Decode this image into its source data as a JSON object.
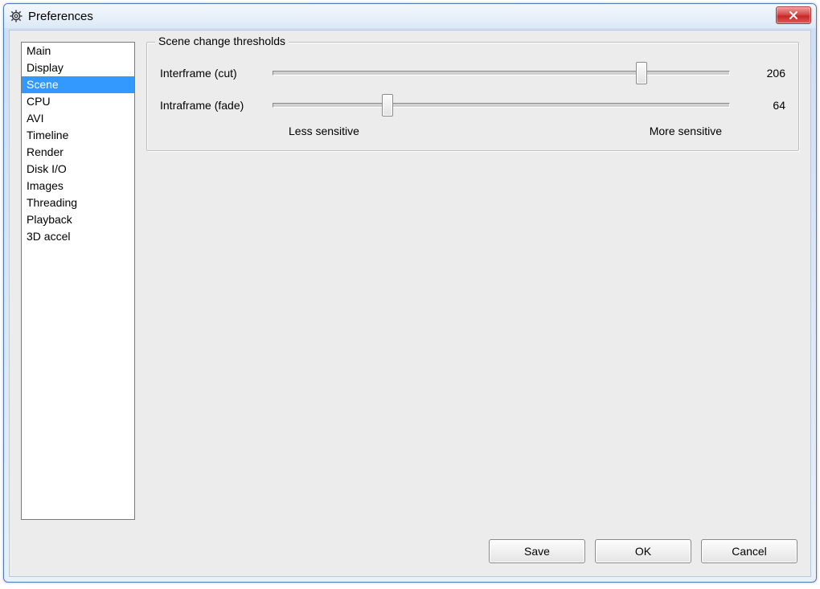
{
  "window": {
    "title": "Preferences"
  },
  "sidebar": {
    "items": [
      "Main",
      "Display",
      "Scene",
      "CPU",
      "AVI",
      "Timeline",
      "Render",
      "Disk I/O",
      "Images",
      "Threading",
      "Playback",
      "3D accel"
    ],
    "selected_index": 2
  },
  "group": {
    "title": "Scene change thresholds",
    "sliders": {
      "interframe": {
        "label": "Interframe (cut)",
        "value": 206,
        "min": 0,
        "max": 255
      },
      "intraframe": {
        "label": "Intraframe (fade)",
        "value": 64,
        "min": 0,
        "max": 255
      }
    },
    "less_label": "Less sensitive",
    "more_label": "More sensitive"
  },
  "buttons": {
    "save": "Save",
    "ok": "OK",
    "cancel": "Cancel"
  }
}
